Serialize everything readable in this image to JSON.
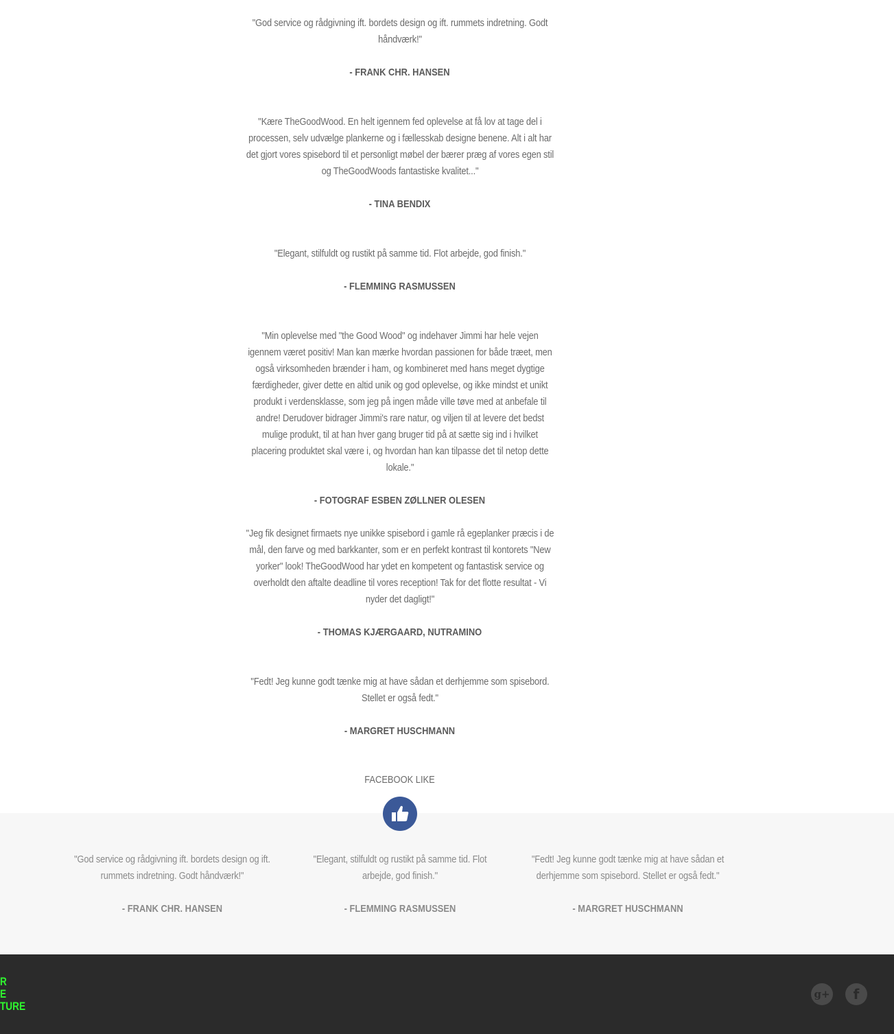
{
  "testimonials": [
    {
      "quote": "\"God service og rådgivning ift. bordets design og ift. rummets indretning. Godt håndværk!\"",
      "author": "- Frank Chr. Hansen"
    },
    {
      "quote": "\"Kære TheGoodWood. En helt igennem fed oplevelse at få lov at tage del i processen, selv udvælge plankerne og i fællesskab designe benene. Alt i alt har det gjort vores spisebord til et personligt møbel der bærer præg af vores egen stil og TheGoodWoods fantastiske kvalitet...\"",
      "author": "- Tina Bendix"
    },
    {
      "quote": "\"Elegant, stilfuldt og rustikt på samme tid. Flot arbejde, god finish.\"",
      "author": "- Flemming Rasmussen"
    },
    {
      "quote": "\"Min oplevelse med \"the Good Wood\" og indehaver Jimmi har hele vejen igennem været positiv! Man kan mærke hvordan passionen for både træet, men også virksomheden brænder i ham, og kombineret med hans meget dygtige færdigheder, giver dette en altid unik og god oplevelse, og ikke mindst et unikt produkt i verdensklasse, som jeg på ingen måde ville tøve med at anbefale til andre! Derudover bidrager Jimmi's rare natur, og viljen til at levere det bedst mulige produkt, til at han hver gang bruger tid på at sætte sig ind i hvilket placering produktet skal være i, og hvordan han kan tilpasse det til netop dette lokale.\"",
      "author": "- Fotograf Esben Zøllner Olesen"
    },
    {
      "quote": "\"Jeg fik designet firmaets nye unikke spisebord i gamle rå egeplanker præcis i de mål, den farve og med barkkanter, som er en perfekt kontrast til kontorets \"New yorker\" look! TheGoodWood har ydet en kompetent og fantastisk service og overholdt den aftalte deadline til vores reception! Tak for det flotte resultat - Vi nyder det dagligt!\"",
      "author": "- Thomas Kjærgaard, Nutramino"
    },
    {
      "quote": "\"Fedt! Jeg kunne godt tænke mig at have sådan et derhjemme som spisebord. Stellet er også fedt.\"",
      "author": "- Margret Huschmann"
    }
  ],
  "facebook": {
    "title": "Facebook like",
    "icon": "thumbs-up-icon"
  },
  "featured": [
    {
      "quote": "\"God service og rådgivning ift. bordets design og ift. rummets indretning. Godt håndværk!\"",
      "author": "- Frank Chr. Hansen"
    },
    {
      "quote": "\"Elegant, stilfuldt og rustikt på samme tid. Flot arbejde, god finish.\"",
      "author": "- Flemming Rasmussen"
    },
    {
      "quote": "\"Fedt! Jeg kunne godt tænke mig at have sådan et derhjemme som spisebord. Stellet er også fedt.\"",
      "author": "- Margret Huschmann"
    }
  ],
  "footer": {
    "logo_lines": [
      "R",
      "E",
      "TURE"
    ],
    "social": [
      {
        "name": "google-plus-icon",
        "glyph": "g+"
      },
      {
        "name": "facebook-icon",
        "glyph": "f"
      }
    ]
  },
  "colors": {
    "accent": "#2ff52f",
    "facebook_blue": "#3b5998",
    "footer_bg": "#2b2b2b"
  }
}
